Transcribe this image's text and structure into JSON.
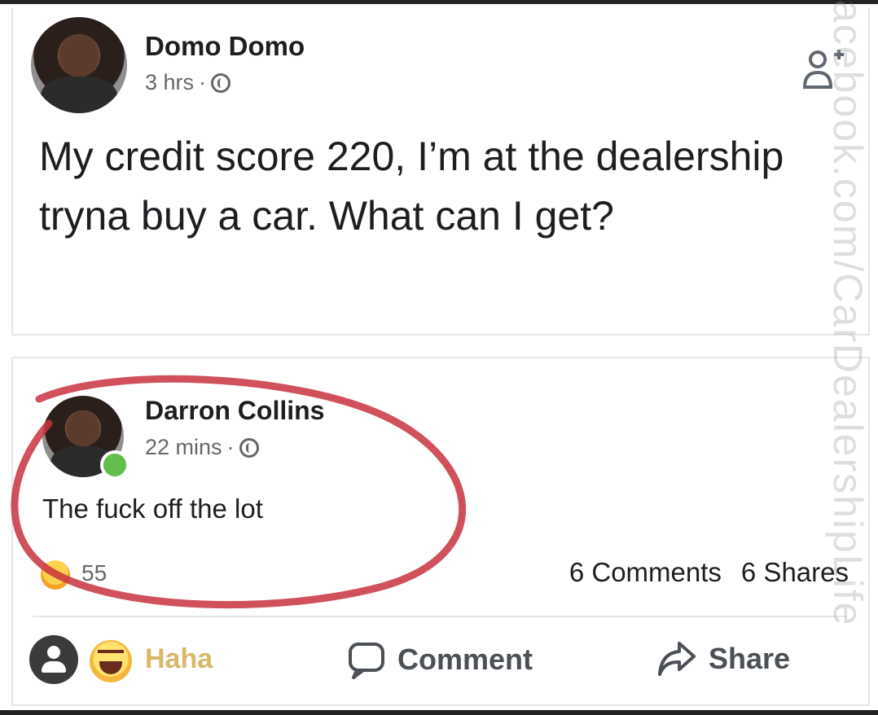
{
  "post": {
    "author": "Domo Domo",
    "time": "3 hrs",
    "separator": "·",
    "text": "My credit score 220, I’m at the dealership tryna buy a car. What can I get?",
    "icons": {
      "privacy": "globe-icon",
      "follow": "add-friend-icon"
    }
  },
  "comment": {
    "author": "Darron Collins",
    "time": "22 mins",
    "separator": "·",
    "text": "The fuck off the lot",
    "reactions_count": "55",
    "comments_count": "6 Comments",
    "shares_count": "6 Shares"
  },
  "actions": {
    "haha_label": "Haha",
    "comment_label": "Comment",
    "share_label": "Share"
  },
  "watermark": "acebook.com/CarDealershipLife",
  "colors": {
    "annotation": "#c8323e",
    "online": "#5fbf49",
    "haha_text": "#d9b86a"
  }
}
